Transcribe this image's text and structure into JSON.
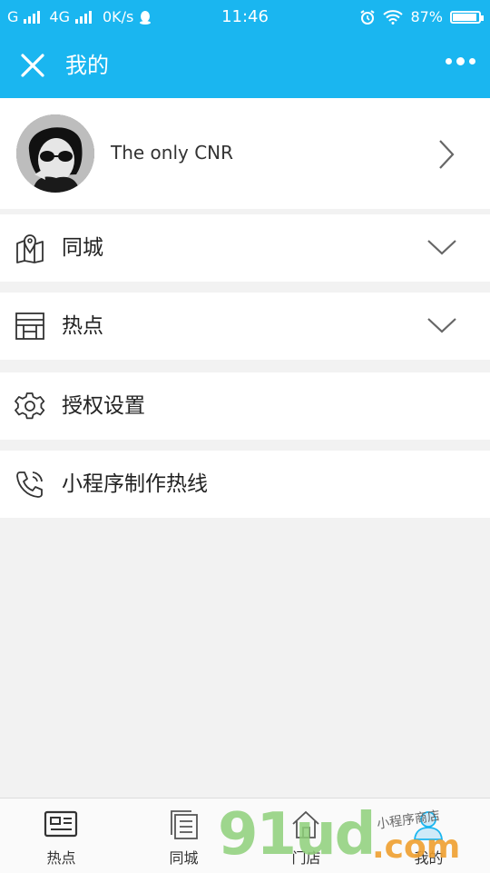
{
  "status_bar": {
    "network_left": "G",
    "network_mid": "4G",
    "speed": "0K/s",
    "time": "11:46",
    "battery_text": "87%",
    "battery_level": 0.87
  },
  "nav": {
    "title": "我的",
    "accent_color": "#1ab6f0"
  },
  "profile": {
    "name": "The only CNR"
  },
  "menu": [
    {
      "label": "同城",
      "icon": "map-icon",
      "expandable": true
    },
    {
      "label": "热点",
      "icon": "store-icon",
      "expandable": true
    },
    {
      "label": "授权设置",
      "icon": "gear-icon",
      "expandable": false
    },
    {
      "label": "小程序制作热线",
      "icon": "phone-icon",
      "expandable": false
    }
  ],
  "tabs": [
    {
      "label": "热点",
      "icon": "news-icon"
    },
    {
      "label": "同城",
      "icon": "list-icon"
    },
    {
      "label": "门店",
      "icon": "home-icon"
    },
    {
      "label": "我的",
      "icon": "user-icon",
      "active": true
    }
  ],
  "watermark": {
    "big": "91ud",
    "com": ".com",
    "small": "小程序商店"
  }
}
